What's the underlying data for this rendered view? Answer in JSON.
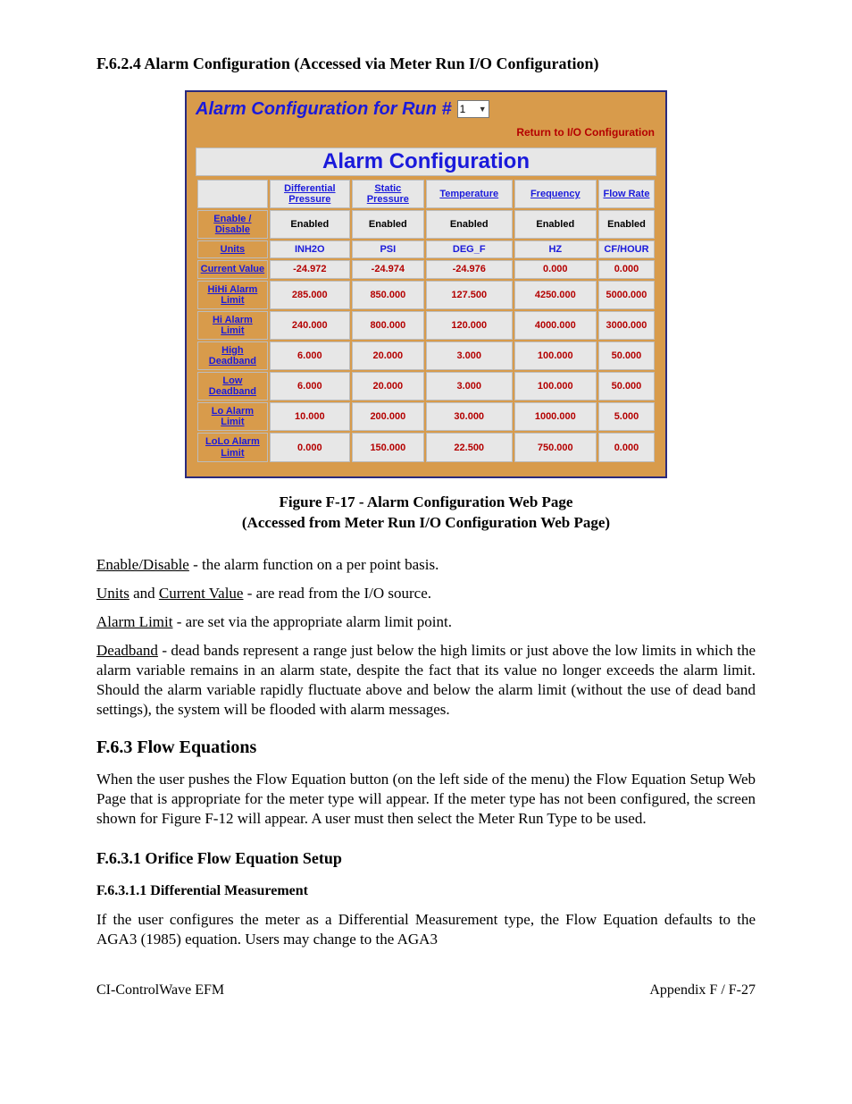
{
  "doc": {
    "heading_f624": "F.6.2.4  Alarm Configuration (Accessed via Meter Run I/O Configuration)",
    "figure_caption_1": "Figure F-17 - Alarm Configuration Web Page",
    "figure_caption_2": "(Accessed from Meter Run I/O Configuration Web Page)",
    "p_enable_label": "Enable/Disable",
    "p_enable_text": " - the alarm function on a per point basis.",
    "p_units_label1": "Units",
    "p_units_mid": " and ",
    "p_units_label2": "Current Value",
    "p_units_text": " - are read from the I/O source.",
    "p_alarm_label": "Alarm Limit",
    "p_alarm_text": " - are set via the appropriate alarm limit point.",
    "p_dead_label": "Deadband",
    "p_dead_text": " - dead bands represent a range just below the high limits or just above the low limits in which the alarm variable remains in an alarm state, despite the fact that its value no longer exceeds the alarm limit. Should the alarm variable rapidly fluctuate above and below the alarm limit (without the use of dead band settings), the system will be flooded with alarm messages.",
    "heading_f63": "F.6.3  Flow Equations",
    "p_f63": "When the user pushes the Flow Equation button (on the left side of the menu) the Flow Equation Setup Web Page that is appropriate for the meter type will appear. If the meter type has not been configured, the screen shown for Figure F-12 will appear. A user must then select the Meter Run Type to be used.",
    "heading_f631": "F.6.3.1  Orifice Flow Equation Setup",
    "heading_f6311": "F.6.3.1.1   Differential Measurement",
    "p_f6311": "If the user configures the meter as a Differential Measurement type, the Flow Equation defaults to the AGA3 (1985) equation. Users may change to the AGA3",
    "footer_left": "CI-ControlWave EFM",
    "footer_right": "Appendix F / F-27"
  },
  "panel": {
    "title_prefix": "Alarm Configuration for Run #",
    "run_value": "1",
    "return_link": "Return to I/O Configuration",
    "config_title": "Alarm Configuration",
    "columns": [
      "Differential Pressure",
      "Static Pressure",
      "Temperature",
      "Frequency",
      "Flow Rate"
    ],
    "rows": [
      {
        "label": "Enable / Disable",
        "type": "btn",
        "values": [
          "Enabled",
          "Enabled",
          "Enabled",
          "Enabled",
          "Enabled"
        ]
      },
      {
        "label": "Units",
        "type": "blue",
        "values": [
          "INH2O",
          "PSI",
          "DEG_F",
          "HZ",
          "CF/HOUR"
        ]
      },
      {
        "label": "Current Value",
        "type": "red",
        "values": [
          "-24.972",
          "-24.974",
          "-24.976",
          "0.000",
          "0.000"
        ]
      },
      {
        "label": "HiHi Alarm Limit",
        "type": "red",
        "values": [
          "285.000",
          "850.000",
          "127.500",
          "4250.000",
          "5000.000"
        ]
      },
      {
        "label": "Hi Alarm Limit",
        "type": "red",
        "values": [
          "240.000",
          "800.000",
          "120.000",
          "4000.000",
          "3000.000"
        ]
      },
      {
        "label": "High Deadband",
        "type": "red",
        "values": [
          "6.000",
          "20.000",
          "3.000",
          "100.000",
          "50.000"
        ]
      },
      {
        "label": "Low Deadband",
        "type": "red",
        "values": [
          "6.000",
          "20.000",
          "3.000",
          "100.000",
          "50.000"
        ]
      },
      {
        "label": "Lo Alarm Limit",
        "type": "red",
        "values": [
          "10.000",
          "200.000",
          "30.000",
          "1000.000",
          "5.000"
        ]
      },
      {
        "label": "LoLo Alarm Limit",
        "type": "red",
        "values": [
          "0.000",
          "150.000",
          "22.500",
          "750.000",
          "0.000"
        ]
      }
    ]
  }
}
